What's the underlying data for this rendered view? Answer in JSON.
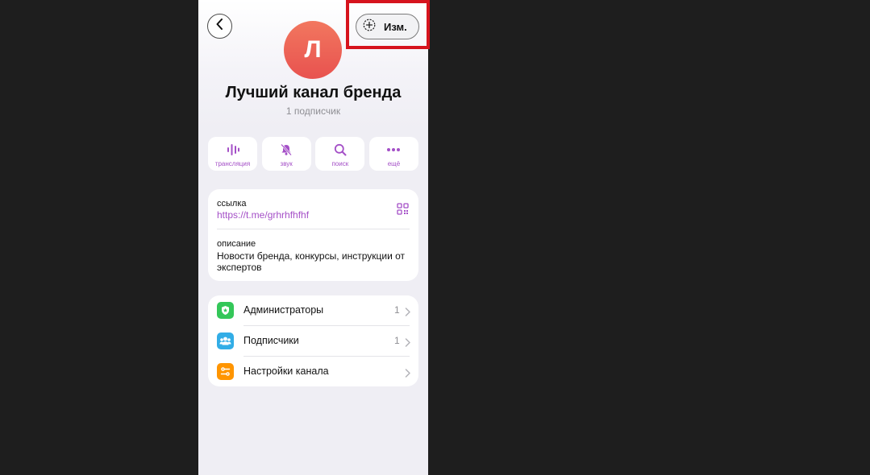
{
  "header": {
    "edit_label": "Изм."
  },
  "channel": {
    "avatar_letter": "Л",
    "title": "Лучший канал бренда",
    "subscribers": "1 подписчик"
  },
  "actions": [
    {
      "label": "трансляция",
      "icon": "broadcast-icon"
    },
    {
      "label": "звук",
      "icon": "bell-muted-icon"
    },
    {
      "label": "поиск",
      "icon": "search-icon"
    },
    {
      "label": "ещё",
      "icon": "more-icon"
    }
  ],
  "info": {
    "link_caption": "ссылка",
    "link_value": "https://t.me/grhrhfhfhf",
    "description_caption": "описание",
    "description_value": "Новости бренда, конкурсы, инструкции от экспертов"
  },
  "menu": [
    {
      "label": "Администраторы",
      "count": "1",
      "icon": "admin-shield-icon",
      "color": "#34c759"
    },
    {
      "label": "Подписчики",
      "count": "1",
      "icon": "subscribers-icon",
      "color": "#32ade6"
    },
    {
      "label": "Настройки канала",
      "count": "",
      "icon": "channel-settings-icon",
      "color": "#ff9500"
    }
  ],
  "colors": {
    "accent": "#a44fc7",
    "avatar": "#ee6656",
    "highlight": "#d6131d"
  }
}
